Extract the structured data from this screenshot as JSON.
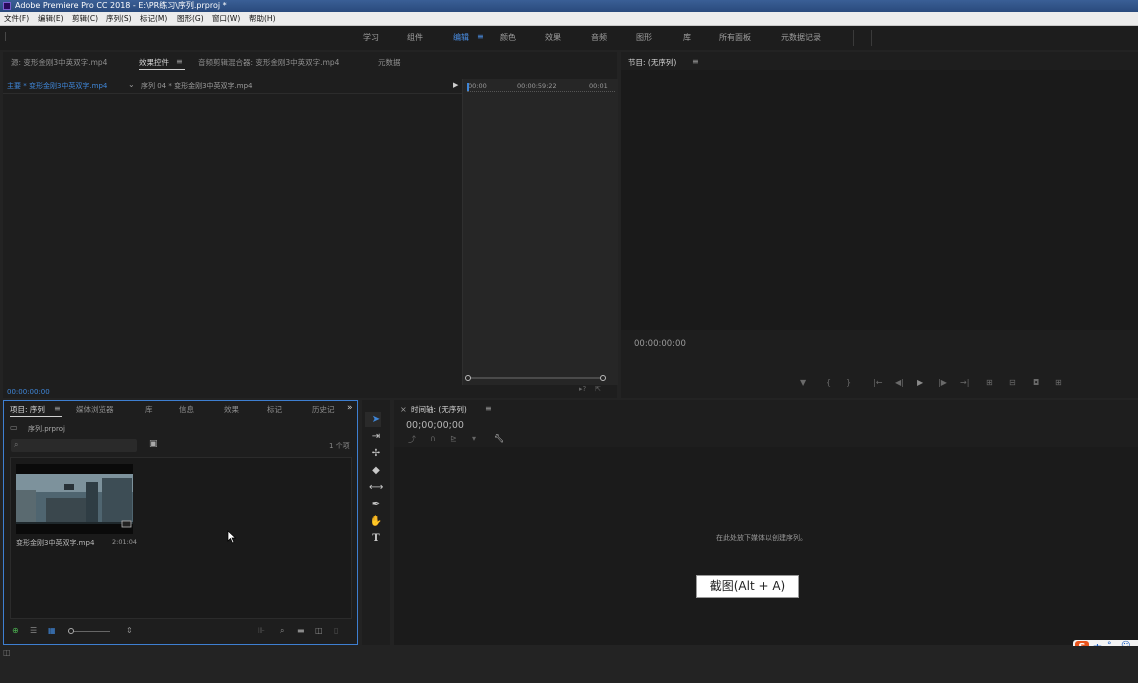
{
  "window": {
    "title": "Adobe Premiere Pro CC 2018 - E:\\PR练习\\序列.prproj *"
  },
  "menu": [
    "文件(F)",
    "编辑(E)",
    "剪辑(C)",
    "序列(S)",
    "标记(M)",
    "图形(G)",
    "窗口(W)",
    "帮助(H)"
  ],
  "workspaces": {
    "items": [
      "学习",
      "组件",
      "编辑",
      "颜色",
      "效果",
      "音频",
      "图形",
      "库",
      "所有面板",
      "元数据记录"
    ],
    "active": "编辑"
  },
  "source_panel": {
    "tabs": [
      "源: 变形金刚3中英双字.mp4",
      "效果控件",
      "音频剪辑混合器: 变形金刚3中英双字.mp4",
      "元数据"
    ],
    "active_tab": "效果控件",
    "master_clip": "主要 * 变形金刚3中英双字.mp4",
    "sequence_clip": "序列 04 * 变形金刚3中英双字.mp4",
    "ruler_start": "00:00",
    "ruler_mid": "00:00:59:22",
    "ruler_end": "00:01",
    "timecode": "00:00:00:00"
  },
  "program_panel": {
    "title": "节目: (无序列)",
    "timecode": "00:00:00:00"
  },
  "project_panel": {
    "tabs": [
      "项目: 序列",
      "媒体浏览器",
      "库",
      "信息",
      "效果",
      "标记",
      "历史记"
    ],
    "active_tab": "项目: 序列",
    "project_file": "序列.prproj",
    "search_placeholder": "",
    "item_count": "1 个项",
    "clip": {
      "name": "变形金刚3中英双字.mp4",
      "duration": "2:01:04"
    }
  },
  "timeline_panel": {
    "title": "时间轴: (无序列)",
    "timecode": "00;00;00;00",
    "empty_message": "在此处放下媒体以创建序列。"
  },
  "tooltip": {
    "text": "截图(Alt + A)"
  },
  "ime": {
    "label": "中"
  }
}
